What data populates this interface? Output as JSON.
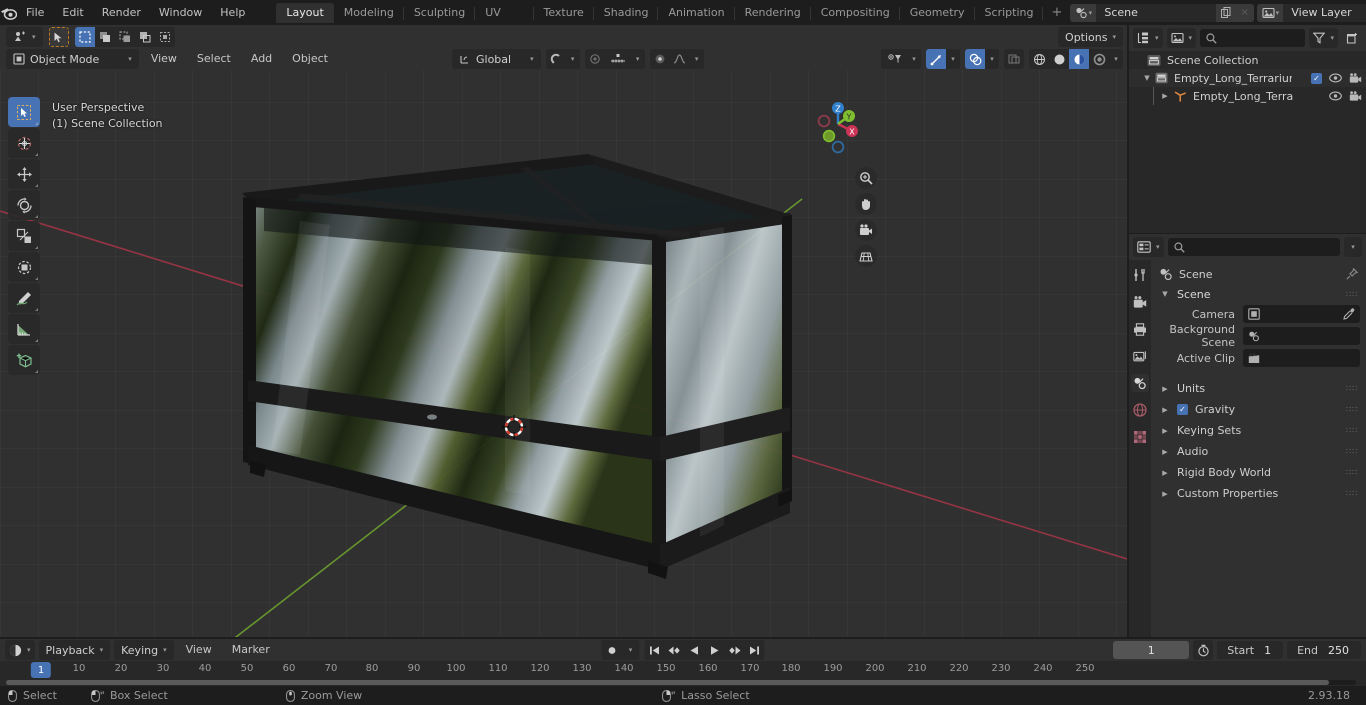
{
  "app": {
    "name": "Blender",
    "version": "2.93.18"
  },
  "topbar": {
    "menus": [
      "File",
      "Edit",
      "Render",
      "Window",
      "Help"
    ],
    "workspaces": [
      {
        "label": "Layout",
        "active": true
      },
      {
        "label": "Modeling",
        "active": false
      },
      {
        "label": "Sculpting",
        "active": false
      },
      {
        "label": "UV Editing",
        "active": false
      },
      {
        "label": "Texture Paint",
        "active": false
      },
      {
        "label": "Shading",
        "active": false
      },
      {
        "label": "Animation",
        "active": false
      },
      {
        "label": "Rendering",
        "active": false
      },
      {
        "label": "Compositing",
        "active": false
      },
      {
        "label": "Geometry Nodes",
        "active": false
      },
      {
        "label": "Scripting",
        "active": false
      }
    ],
    "add_workspace": "+",
    "scene": {
      "name": "Scene",
      "icon": "scene-icon",
      "copy": "copy-icon",
      "unlink": "×"
    },
    "view_layer": {
      "name": "View Layer",
      "icon": "view-layer-icon",
      "copy": "copy-icon",
      "unlink": "×"
    }
  },
  "viewport": {
    "mode": "Object Mode",
    "menus": [
      "View",
      "Select",
      "Add",
      "Object"
    ],
    "transform_orientation": "Global",
    "options_label": "Options",
    "overlay_line1": "User Perspective",
    "overlay_line2": "(1) Scene Collection",
    "tools": [
      "tweak-select-tool",
      "cursor-tool",
      "move-tool",
      "rotate-tool",
      "scale-tool",
      "transform-tool",
      "annotate-tool",
      "measure-tool",
      "add-cube-tool"
    ],
    "gizmo_axes": [
      "X",
      "Y",
      "Z"
    ],
    "nav_buttons": [
      "zoom-icon",
      "pan-hand-icon",
      "camera-icon",
      "grid-ortho-icon"
    ],
    "shading_modes": [
      "wireframe",
      "solid",
      "material-preview",
      "rendered"
    ],
    "active_shading_mode": "material-preview"
  },
  "outliner": {
    "search_placeholder": "",
    "rows": [
      {
        "label": "Scene Collection",
        "icon": "collection-icon",
        "depth": 0,
        "expandable": false,
        "checkbox": false,
        "eye": false,
        "camera": false
      },
      {
        "label": "Empty_Long_Terrarium_for_E",
        "icon": "collection-icon",
        "depth": 1,
        "expandable": true,
        "expanded": true,
        "checkbox": true,
        "eye": true,
        "camera": true
      },
      {
        "label": "Empty_Long_Terrarium_f",
        "icon": "empty-axes-icon",
        "depth": 2,
        "expandable": true,
        "expanded": false,
        "checkbox": false,
        "eye": true,
        "camera": true
      }
    ]
  },
  "properties": {
    "tabs": [
      "tool-icon",
      "render-icon",
      "output-icon",
      "view-layer-icon",
      "scene-icon",
      "world-icon",
      "texture-icon"
    ],
    "active_tab": "scene-icon",
    "breadcrumb": "Scene",
    "panel_title": "Scene",
    "fields": [
      {
        "label": "Camera",
        "value": "",
        "icon": "camera-data-icon",
        "has_eyedropper": true
      },
      {
        "label": "Background Scene",
        "value": "",
        "icon": "scene-icon",
        "has_eyedropper": false
      },
      {
        "label": "Active Clip",
        "value": "",
        "icon": "movie-clip-icon",
        "has_eyedropper": false
      }
    ],
    "sections": [
      {
        "label": "Units",
        "expanded": false,
        "checkbox": null
      },
      {
        "label": "Gravity",
        "expanded": false,
        "checkbox": true
      },
      {
        "label": "Keying Sets",
        "expanded": false,
        "checkbox": null
      },
      {
        "label": "Audio",
        "expanded": false,
        "checkbox": null
      },
      {
        "label": "Rigid Body World",
        "expanded": false,
        "checkbox": null
      },
      {
        "label": "Custom Properties",
        "expanded": false,
        "checkbox": null
      }
    ]
  },
  "timeline": {
    "menus": [
      "Playback",
      "Keying",
      "View",
      "Marker"
    ],
    "current_frame": "1",
    "start_label": "Start",
    "start_value": "1",
    "end_label": "End",
    "end_value": "250",
    "playhead_frame": "1",
    "ticks": [
      "10",
      "20",
      "30",
      "40",
      "50",
      "60",
      "70",
      "80",
      "90",
      "100",
      "110",
      "120",
      "130",
      "140",
      "150",
      "160",
      "170",
      "180",
      "190",
      "200",
      "210",
      "220",
      "230",
      "240",
      "250"
    ],
    "transport": [
      "jump-start-icon",
      "prev-keyframe-icon",
      "play-reverse-icon",
      "play-icon",
      "next-keyframe-icon",
      "jump-end-icon"
    ],
    "record_icon": "record-icon"
  },
  "statusbar": {
    "items": [
      {
        "icon": "mouse-left-icon",
        "label": "Select"
      },
      {
        "icon": "mouse-left-drag-icon",
        "label": "Box Select"
      },
      {
        "icon": "mouse-middle-icon",
        "label": "Zoom View"
      },
      {
        "icon": "mouse-right-drag-icon",
        "label": "Lasso Select"
      }
    ],
    "version": "2.93.18"
  },
  "colors": {
    "accent": "#4772b3",
    "viewport_bg": "#303030",
    "panel_bg": "#282828",
    "x_axis": "#cc3355",
    "y_axis": "#7fbf2f",
    "z_axis": "#2f7fcc"
  }
}
